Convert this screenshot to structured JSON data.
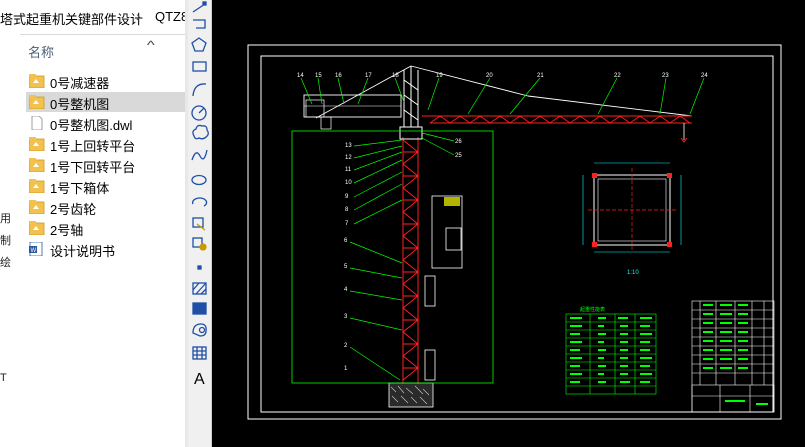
{
  "explorer": {
    "breadcrumb": "塔式起重机关键部件设计",
    "breadcrumb_sep": "›",
    "breadcrumb_next": "QTZ8",
    "column_header": "名称",
    "left_fragments": [
      "用",
      "制",
      "绘",
      "T"
    ],
    "items": [
      {
        "label": "0号减速器",
        "icon": "cad-file-icon"
      },
      {
        "label": "0号整机图",
        "icon": "cad-file-icon"
      },
      {
        "label": "0号整机图.dwl",
        "icon": "blank-file-icon"
      },
      {
        "label": "1号上回转平台",
        "icon": "cad-file-icon"
      },
      {
        "label": "1号下回转平台",
        "icon": "cad-file-icon"
      },
      {
        "label": "1号下箱体",
        "icon": "cad-file-icon"
      },
      {
        "label": "2号齿轮",
        "icon": "cad-file-icon"
      },
      {
        "label": "2号轴",
        "icon": "cad-file-icon"
      },
      {
        "label": "设计说明书",
        "icon": "word-doc-icon"
      }
    ],
    "selected_index": 1
  },
  "toolbar": {
    "tools": [
      "line-tool-icon",
      "polyline-tool-icon",
      "polygon-tool-icon",
      "rectangle-tool-icon",
      "arc-tool-icon",
      "circle-tool-icon",
      "revcloud-tool-icon",
      "spline-tool-icon",
      "ellipse-tool-icon",
      "ellipse-arc-tool-icon",
      "insert-block-icon",
      "make-block-icon",
      "point-tool-icon",
      "hatch-tool-icon",
      "gradient-tool-icon",
      "region-tool-icon",
      "table-tool-icon",
      "mtext-tool-icon"
    ],
    "text_tool_label": "A"
  },
  "drawing": {
    "callouts_jib": [
      "14",
      "15",
      "16",
      "17",
      "18",
      "19",
      "20",
      "21",
      "22",
      "23",
      "24"
    ],
    "callouts_tower": [
      "13",
      "12",
      "11",
      "10",
      "9",
      "8",
      "7",
      "6",
      "5",
      "4",
      "3",
      "2",
      "1"
    ],
    "callouts_right": [
      "26",
      "25"
    ],
    "scale_label": "1:10",
    "table_title": "起重性能表",
    "colors": {
      "frame": "#ffffff",
      "outline": "#00ff00",
      "crane": "#ff2020",
      "dim": "#00ffff",
      "hatch": "#ffffff"
    }
  }
}
